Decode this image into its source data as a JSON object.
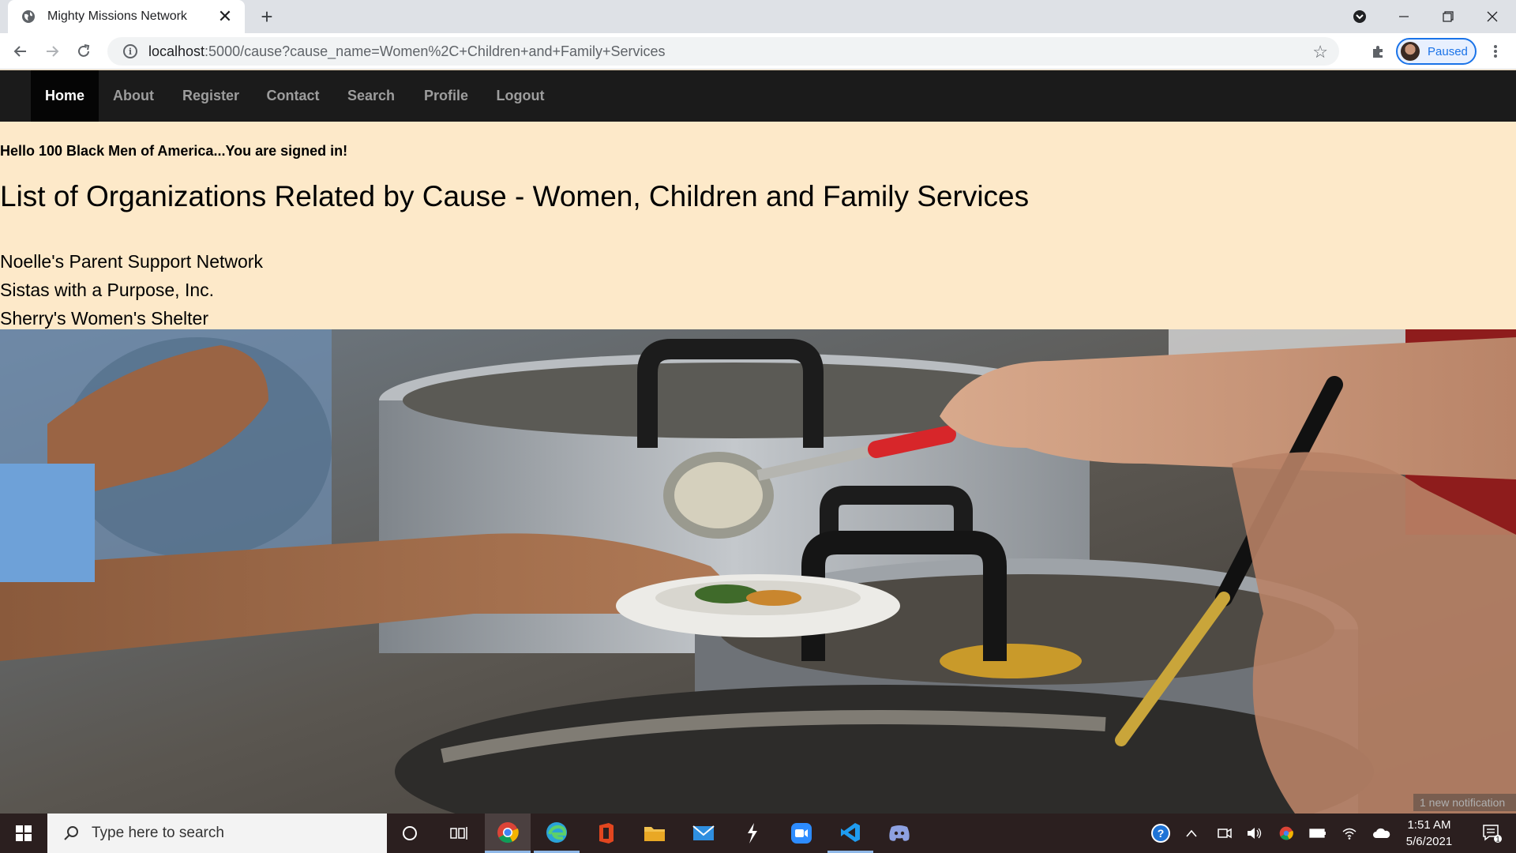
{
  "browser": {
    "tab_title": "Mighty Missions Network",
    "url_host": "localhost",
    "url_rest": ":5000/cause?cause_name=Women%2C+Children+and+Family+Services",
    "profile_status": "Paused"
  },
  "nav": {
    "items": [
      {
        "label": "Home",
        "active": true
      },
      {
        "label": "About"
      },
      {
        "label": "Register"
      },
      {
        "label": "Contact"
      },
      {
        "label": "Search"
      },
      {
        "label": "Profile"
      },
      {
        "label": "Logout"
      }
    ]
  },
  "page": {
    "greeting": "Hello 100 Black Men of America...You are signed in!",
    "title": "List of Organizations Related by Cause - Women, Children and Family Services",
    "organizations": [
      "Noelle's Parent Support Network",
      "Sistas with a Purpose, Inc.",
      "Sherry's Women's Shelter"
    ]
  },
  "taskbar": {
    "search_placeholder": "Type here to search",
    "time": "1:51 AM",
    "date": "5/6/2021",
    "notification_count": "1",
    "toast": "1 new notification"
  },
  "colors": {
    "page_bg": "#fde9c9",
    "nav_bg": "#1b1b1b",
    "nav_active_bg": "#050505",
    "nav_text": "#9d9d9d"
  }
}
